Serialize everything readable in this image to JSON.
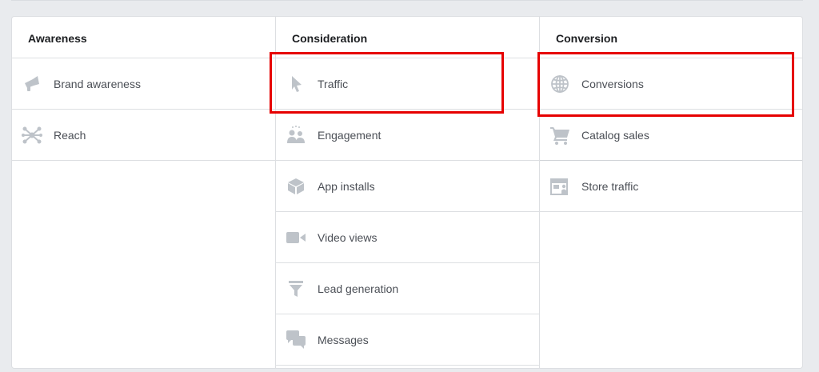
{
  "columns": [
    {
      "header": "Awareness",
      "items": [
        {
          "label": "Brand awareness",
          "icon": "megaphone-icon"
        },
        {
          "label": "Reach",
          "icon": "reach-network-icon"
        }
      ]
    },
    {
      "header": "Consideration",
      "items": [
        {
          "label": "Traffic",
          "icon": "cursor-icon"
        },
        {
          "label": "Engagement",
          "icon": "people-icon"
        },
        {
          "label": "App installs",
          "icon": "box-icon"
        },
        {
          "label": "Video views",
          "icon": "video-camera-icon"
        },
        {
          "label": "Lead generation",
          "icon": "funnel-icon"
        },
        {
          "label": "Messages",
          "icon": "chat-bubbles-icon"
        }
      ]
    },
    {
      "header": "Conversion",
      "items": [
        {
          "label": "Conversions",
          "icon": "globe-icon"
        },
        {
          "label": "Catalog sales",
          "icon": "shopping-cart-icon"
        },
        {
          "label": "Store traffic",
          "icon": "store-icon"
        }
      ]
    }
  ],
  "colors": {
    "icon": "#bec3c9",
    "highlight": "#e60000",
    "text": "#4b4f56",
    "header_text": "#1c1e21",
    "border": "#dddfe2",
    "background": "#e9ebee"
  }
}
